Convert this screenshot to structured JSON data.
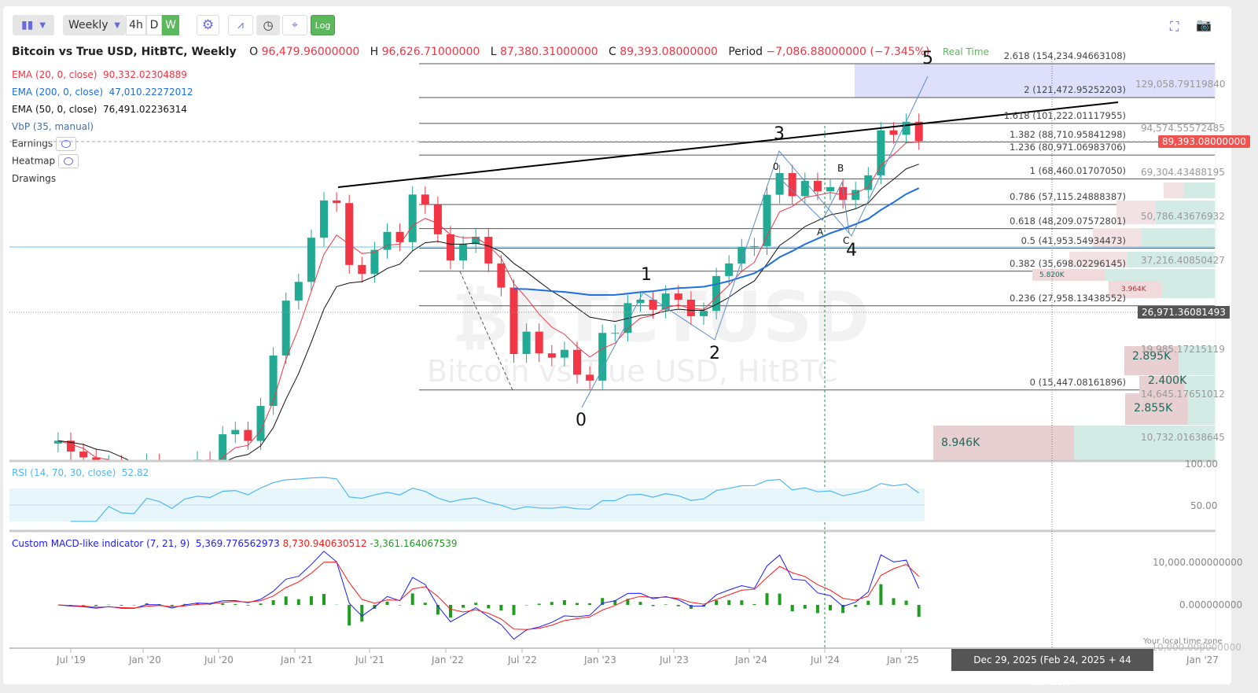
{
  "toolbar": {
    "chart_type_icon": "candles-icon",
    "interval_label": "Weekly",
    "quick_intervals": [
      "4h",
      "D",
      "W"
    ],
    "active_interval": "W",
    "settings_icon": "gear-icon",
    "indicator_icon": "indicator-icon",
    "replay_icon": "clock-icon",
    "crosshair_icon": "crosshair-icon",
    "log_label": "Log",
    "fullscreen_icon": "fullscreen-icon",
    "camera_icon": "camera-icon"
  },
  "header": {
    "title": "Bitcoin vs True USD, HitBTC, Weekly",
    "o_label": "O",
    "o_value": "96,479.96000000",
    "h_label": "H",
    "h_value": "96,626.71000000",
    "l_label": "L",
    "l_value": "87,380.31000000",
    "c_label": "C",
    "c_value": "89,393.08000000",
    "period_label": "Period",
    "period_value": "−7,086.88000000 (−7.345%)",
    "realtime": "Real Time"
  },
  "legend": {
    "ema20_label": "EMA (20, 0, close)",
    "ema20_value": "90,332.02304889",
    "ema200_label": "EMA (200, 0, close)",
    "ema200_value": "47,010.22272012",
    "ema50_label": "EMA (50, 0, close)",
    "ema50_value": "76,491.02236314",
    "vbp_label": "VbP (35, manual)",
    "earnings_label": "Earnings",
    "heatmap_label": "Heatmap",
    "drawings_label": "Drawings"
  },
  "watermark": {
    "symbol": "₿BTCTUSD",
    "name": "Bitcoin vs True USD, HitBTC"
  },
  "colors": {
    "up": "#22ab94",
    "down": "#f23645",
    "ema20": "#f23645",
    "ema50": "#111111",
    "ema200": "#1e6fe0",
    "rsi": "#4fb8f0",
    "macd": "#1a1aff",
    "signal": "#ff1a1a",
    "hist": "#1f9d1f"
  },
  "chart_data": [
    {
      "type": "candlestick",
      "title": "Bitcoin vs True USD, HitBTC, Weekly",
      "scale": "log",
      "ylim": [
        10732,
        154235
      ],
      "x_start": "2019-06",
      "x_step": "month",
      "x_ticks": [
        "Jul '19",
        "Jan '20",
        "Jul '20",
        "Jan '21",
        "Jul '21",
        "Jan '22",
        "Jul '22",
        "Jan '23",
        "Jul '23",
        "Jan '24",
        "Jul '24",
        "Jan '25",
        "Jan '27"
      ],
      "closes": [
        10800,
        10000,
        9600,
        8300,
        9200,
        7500,
        7200,
        9300,
        8600,
        6400,
        8600,
        9450,
        9130,
        11300,
        11650,
        10780,
        13800,
        19700,
        29000,
        33100,
        45200,
        58800,
        57700,
        37300,
        35000,
        41500,
        47100,
        43800,
        61300,
        57000,
        46300,
        38500,
        43200,
        45500,
        37700,
        31800,
        19900,
        23300,
        20000,
        19400,
        20500,
        17200,
        16500,
        23100,
        23100,
        28500,
        29200,
        27200,
        30500,
        29200,
        26000,
        27000,
        34500,
        37700,
        42300,
        42600,
        61200,
        71300,
        60600,
        67500,
        62700,
        64600,
        59000,
        63300,
        70200,
        96400,
        93400,
        102400,
        89393
      ],
      "fib_levels": [
        {
          "label": "2.618 (154,234.94663108)",
          "price": 154234.95
        },
        {
          "label": "2 (121,472.95252203)",
          "price": 121472.95
        },
        {
          "label": "1.618 (101,222.01117955)",
          "price": 101222.01
        },
        {
          "label": "1.382 (88,710.95841298)",
          "price": 88710.96
        },
        {
          "label": "1.236 (80,971.06983706)",
          "price": 80971.07
        },
        {
          "label": "1 (68,460.01707050)",
          "price": 68460.02
        },
        {
          "label": "0.786 (57,115.24888387)",
          "price": 57115.25
        },
        {
          "label": "0.618 (48,209.07572801)",
          "price": 48209.08
        },
        {
          "label": "0.5 (41,953.54934473)",
          "price": 41953.55
        },
        {
          "label": "0.382 (35,698.02296145)",
          "price": 35698.02
        },
        {
          "label": "0.236 (27,958.13438552)",
          "price": 27958.13
        },
        {
          "label": "0 (15,447.08161896)",
          "price": 15447.08
        }
      ],
      "price_axis_labels": [
        "129,058.79119840",
        "94,574.55572485",
        "69,304.43488195",
        "50,786.43676932",
        "37,216.40850427",
        "19,985.17215119",
        "14,645.17651012",
        "10,732.01638645"
      ],
      "last_price_badge": "89,393.08000000",
      "crosshair_price_badge": "26,971.36081493",
      "elliott_labels": [
        "0",
        "1",
        "2",
        "3",
        "4",
        "5"
      ],
      "correction_labels": [
        "0",
        "A",
        "B",
        "C"
      ],
      "vbp_labels": [
        "8.946K",
        "2.855K",
        "2.400K",
        "2.895K",
        "3.964K",
        "5.820K"
      ]
    },
    {
      "type": "line",
      "title": "RSI (14, 70, 30, close)",
      "last_value": "52.82",
      "ylim": [
        0,
        100
      ],
      "y_ticks": [
        "100.00",
        "50.00"
      ],
      "band": [
        30,
        70
      ]
    },
    {
      "type": "line+bar",
      "title": "Custom MACD-like indicator (7, 21, 9)",
      "values": [
        "5,369.776562973",
        "8,730.940630512",
        "-3,361.164067539"
      ],
      "y_ticks": [
        "10,000.000000000",
        "0.000000000",
        "-10,000.000000000"
      ]
    }
  ],
  "footer": {
    "timezone": "Your local time zone",
    "crosshair_time": "Dec 29, 2025 (Feb 24, 2025 + 44 candles)."
  }
}
